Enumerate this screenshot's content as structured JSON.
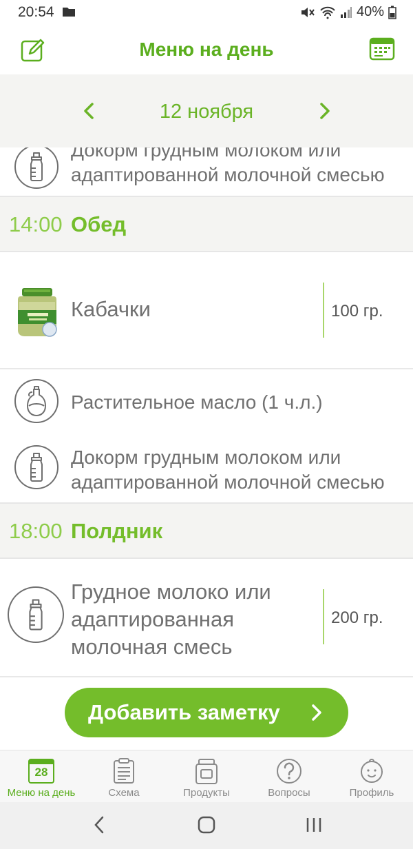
{
  "status_bar": {
    "time": "20:54",
    "battery": "40%"
  },
  "app_bar": {
    "title": "Меню на день"
  },
  "date_nav": {
    "date": "12 ноября"
  },
  "items_top": {
    "feeding_text": "Докорм грудным молоком или адаптированной молочной смесью"
  },
  "sections": [
    {
      "time": "14:00",
      "name": "Обед",
      "items": [
        {
          "icon": "jar-image",
          "label": "Кабачки",
          "qty": "100 гр."
        },
        {
          "icon": "oil-bottle-icon",
          "label": "Растительное масло (1 ч.л.)"
        },
        {
          "icon": "baby-bottle-icon",
          "label": "Докорм грудным молоком или адаптированной молочной смесью"
        }
      ]
    },
    {
      "time": "18:00",
      "name": "Полдник",
      "items": [
        {
          "icon": "baby-bottle-icon",
          "label": "Грудное молоко или адаптированная молочная смесь",
          "qty": "200 гр."
        }
      ]
    }
  ],
  "add_note": {
    "label": "Добавить заметку"
  },
  "bottom_nav": [
    {
      "label": "Меню на день",
      "icon": "calendar-icon",
      "badge": "28",
      "active": true
    },
    {
      "label": "Схема",
      "icon": "clipboard-icon"
    },
    {
      "label": "Продукты",
      "icon": "jar-icon"
    },
    {
      "label": "Вопросы",
      "icon": "question-icon"
    },
    {
      "label": "Профиль",
      "icon": "baby-face-icon"
    }
  ],
  "colors": {
    "accent": "#74bd2b",
    "accent_dark": "#5bae1e",
    "section_bg": "#f4f4f2"
  }
}
